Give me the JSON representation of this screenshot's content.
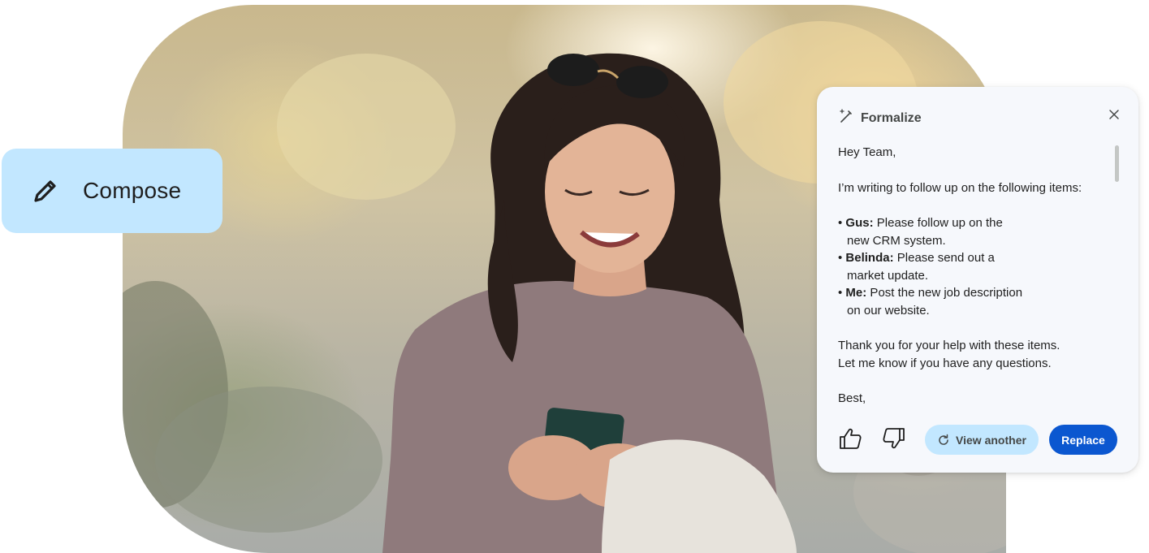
{
  "compose": {
    "label": "Compose",
    "icon": "pencil-icon"
  },
  "panel": {
    "title": "Formalize",
    "title_icon": "magic-pen-icon",
    "close_icon": "close-icon",
    "greeting": "Hey Team,",
    "intro": "I’m writing to follow up on the following items:",
    "items": [
      {
        "name": "Gus:",
        "line1": " Please follow up on the",
        "line2": "new CRM system."
      },
      {
        "name": "Belinda:",
        "line1": " Please send out a",
        "line2": "market update."
      },
      {
        "name": "Me:",
        "line1": " Post the new job description",
        "line2": "on our website."
      }
    ],
    "closing_line1": "Thank you for your help with these items.",
    "closing_line2": "Let me know if you have any questions.",
    "signoff": "Best,",
    "actions": {
      "like_icon": "thumbs-up-icon",
      "dislike_icon": "thumbs-down-icon",
      "view_another": "View another",
      "replace": "Replace"
    }
  },
  "colors": {
    "compose_bg": "#c2e7ff",
    "panel_bg": "#f6f8fc",
    "primary_button": "#0b57d0",
    "secondary_button": "#c2e7ff"
  }
}
